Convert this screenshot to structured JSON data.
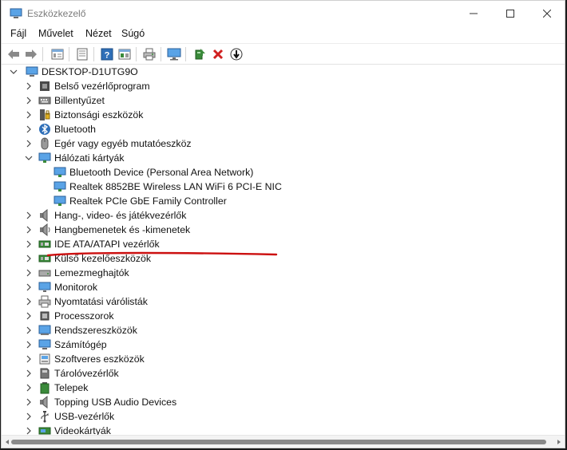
{
  "window": {
    "title": "Eszközkezelő"
  },
  "menu": [
    "Fájl",
    "Művelet",
    "Nézet",
    "Súgó"
  ],
  "colors": {
    "annotation": "#cc1010",
    "accent": "#2f6fb8",
    "delete": "#d02020"
  },
  "toolbar": [
    "back-arrow-icon",
    "forward-arrow-icon",
    "properties-icon",
    "update-driver-icon",
    "help-icon",
    "view-icon",
    "print-icon",
    "monitor-icon",
    "add-hardware-icon",
    "uninstall-icon",
    "disable-device-icon"
  ],
  "tree": {
    "root": "DESKTOP-D1UTG9O",
    "categories": [
      {
        "label": "Belső vezérlőprogram",
        "icon": "firmware-icon",
        "expanded": false
      },
      {
        "label": "Billentyűzet",
        "icon": "keyboard-icon",
        "expanded": false
      },
      {
        "label": "Biztonsági eszközök",
        "icon": "security-device-icon",
        "expanded": false
      },
      {
        "label": "Bluetooth",
        "icon": "bluetooth-icon",
        "expanded": false
      },
      {
        "label": "Egér vagy egyéb mutatóeszköz",
        "icon": "mouse-icon",
        "expanded": false
      },
      {
        "label": "Hálózati kártyák",
        "icon": "network-adapter-icon",
        "expanded": true,
        "children": [
          "Bluetooth Device (Personal Area Network)",
          "Realtek 8852BE Wireless LAN WiFi 6 PCI-E NIC",
          "Realtek PCIe GbE Family Controller"
        ]
      },
      {
        "label": "Hang-, video- és játékvezérlők",
        "icon": "sound-icon",
        "expanded": false
      },
      {
        "label": "Hangbemenetek és -kimenetek",
        "icon": "audio-io-icon",
        "expanded": false
      },
      {
        "label": "IDE ATA/ATAPI vezérlők",
        "icon": "ide-controller-icon",
        "expanded": false
      },
      {
        "label": "Külső kezelőeszközök",
        "icon": "hid-icon",
        "expanded": false
      },
      {
        "label": "Lemezmeghajtók",
        "icon": "disk-drive-icon",
        "expanded": false
      },
      {
        "label": "Monitorok",
        "icon": "monitor-icon",
        "expanded": false
      },
      {
        "label": "Nyomtatási várólisták",
        "icon": "printer-icon",
        "expanded": false
      },
      {
        "label": "Processzorok",
        "icon": "processor-icon",
        "expanded": false
      },
      {
        "label": "Rendszereszközök",
        "icon": "system-device-icon",
        "expanded": false
      },
      {
        "label": "Számítógép",
        "icon": "computer-icon",
        "expanded": false
      },
      {
        "label": "Szoftveres eszközök",
        "icon": "software-device-icon",
        "expanded": false
      },
      {
        "label": "Tárolóvezérlők",
        "icon": "storage-controller-icon",
        "expanded": false
      },
      {
        "label": "Telepek",
        "icon": "battery-icon",
        "expanded": false
      },
      {
        "label": "Topping USB Audio Devices",
        "icon": "usb-audio-icon",
        "expanded": false
      },
      {
        "label": "USB-vezérlők",
        "icon": "usb-icon",
        "expanded": false
      },
      {
        "label": "Videokártyák",
        "icon": "display-adapter-icon",
        "expanded": false
      }
    ]
  },
  "highlight": {
    "annotation": "red-underline-icon",
    "target_child": "Realtek 8852BE Wireless LAN WiFi 6 PCI-E NIC"
  }
}
